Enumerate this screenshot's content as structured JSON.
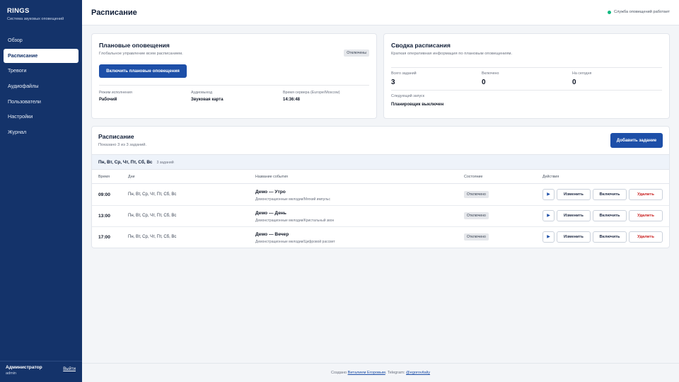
{
  "brand": {
    "title": "RINGS",
    "subtitle": "Система звуковых оповещений"
  },
  "nav": [
    {
      "label": "Обзор"
    },
    {
      "label": "Расписание"
    },
    {
      "label": "Тревоги"
    },
    {
      "label": "Аудиофайлы"
    },
    {
      "label": "Пользователи"
    },
    {
      "label": "Настройки"
    },
    {
      "label": "Журнал"
    }
  ],
  "user": {
    "name": "Администратор",
    "role": "admin",
    "logout": "Выйти"
  },
  "header": {
    "title": "Расписание",
    "status": "Служба оповещений работает",
    "status_color": "#10b981"
  },
  "planned": {
    "title": "Плановые оповещения",
    "subtitle": "Глобальное управление всем расписанием.",
    "badge": "Отключены",
    "button": "Включить плановые оповещения",
    "mode_label": "Режим исполнения",
    "mode_value": "Рабочий",
    "audio_label": "Аудиовыход",
    "audio_value": "Звуковая карта",
    "server_label": "Время сервера (Europe/Moscow)",
    "server_value": "14:36:48"
  },
  "summary": {
    "title": "Сводка расписания",
    "subtitle": "Краткая оперативная информация по плановым оповещениям.",
    "total_label": "Всего заданий",
    "total_value": "3",
    "enabled_label": "Включено",
    "enabled_value": "0",
    "today_label": "На сегодня",
    "today_value": "0",
    "next_label": "Следующий запуск",
    "next_value": "Планировщик выключен"
  },
  "schedule": {
    "title": "Расписание",
    "subtitle": "Показано 3 из 3 заданий.",
    "add_button": "Добавить задание",
    "group_days": "Пн, Вт, Ср, Чт, Пт, Сб, Вс",
    "group_count": "3 заданий",
    "columns": {
      "time": "Время",
      "days": "Дни",
      "event": "Название события",
      "state": "Состояние",
      "actions": "Действия"
    },
    "rows": [
      {
        "time": "09:00",
        "days": "Пн, Вт, Ср, Чт, Пт, Сб, Вс",
        "name": "Демо — Утро",
        "desc": "Демонстрационные мелодии/Мягкий импульс",
        "state": "Отключено"
      },
      {
        "time": "13:00",
        "days": "Пн, Вт, Ср, Чт, Пт, Сб, Вс",
        "name": "Демо — День",
        "desc": "Демонстрационные мелодии/Кристальный звон",
        "state": "Отключено"
      },
      {
        "time": "17:00",
        "days": "Пн, Вт, Ср, Чт, Пт, Сб, Вс",
        "name": "Демо — Вечер",
        "desc": "Демонстрационные мелодии/Цифровой рассвет",
        "state": "Отключено"
      }
    ],
    "actions": {
      "play_icon": "▶",
      "edit": "Изменить",
      "enable": "Включить",
      "delete": "Удалить"
    }
  },
  "footer": {
    "prefix": "Создано",
    "author": "Виталием Егоровым",
    "middle": ". Telegram:",
    "telegram": "@egorovitaliy"
  }
}
